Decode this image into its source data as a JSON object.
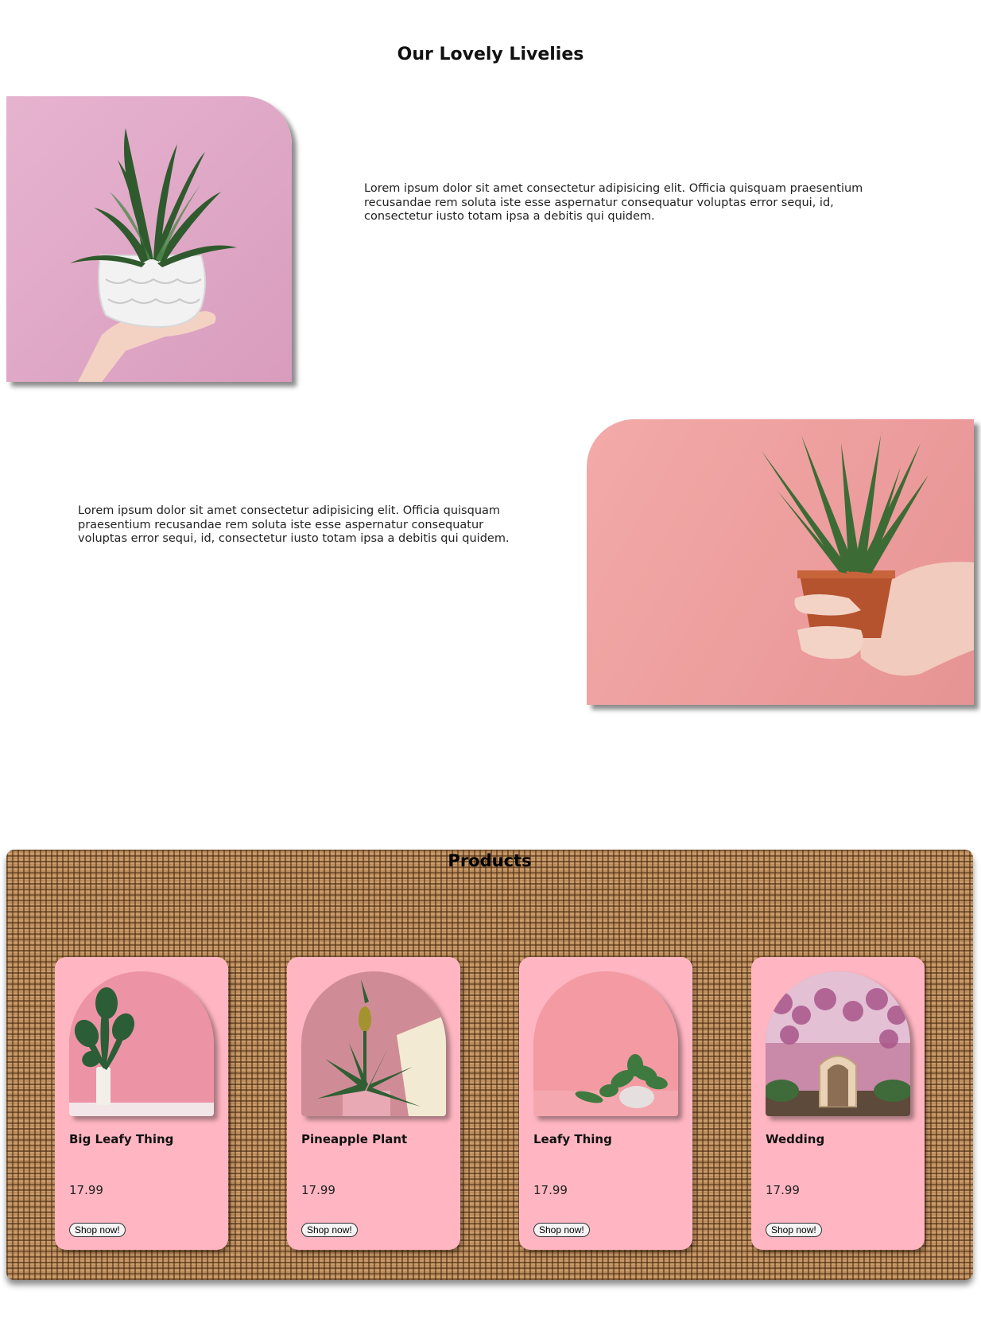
{
  "page": {
    "title": "Our Lovely Livelies"
  },
  "features": [
    {
      "text": "Lorem ipsum dolor sit amet consectetur adipisicing elit. Officia quisquam praesentium recusandae rem soluta iste esse aspernatur consequatur voluptas error sequi, id, consectetur iusto totam ipsa a debitis qui quidem."
    },
    {
      "text": "Lorem ipsum dolor sit amet consectetur adipisicing elit. Officia quisquam praesentium recusandae rem soluta iste esse aspernatur consequatur voluptas error sequi, id, consectetur iusto totam ipsa a debitis qui quidem."
    }
  ],
  "products": {
    "title": "Products",
    "items": [
      {
        "name": "Big Leafy Thing",
        "price": "17.99",
        "button": "Shop now!"
      },
      {
        "name": "Pineapple Plant",
        "price": "17.99",
        "button": "Shop now!"
      },
      {
        "name": "Leafy Thing",
        "price": "17.99",
        "button": "Shop now!"
      },
      {
        "name": "Wedding",
        "price": "17.99",
        "button": "Shop now!"
      }
    ]
  },
  "colors": {
    "card_background": "#ffb6c2",
    "feature_one_background": "#e6b3cf",
    "feature_two_background": "#f2aaa8",
    "burlap": "#b9895a"
  }
}
